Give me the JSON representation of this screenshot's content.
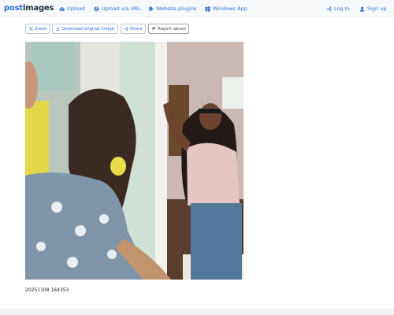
{
  "brand": {
    "part1": "post",
    "part2": "images"
  },
  "nav": {
    "upload": "Upload",
    "upload_url": "Upload via URL",
    "plugins": "Website plugins",
    "windows": "Windows App",
    "login": "Log In",
    "signup": "Sign up"
  },
  "toolbar": {
    "zoom": "Zoom",
    "download": "Download original image",
    "share": "Share",
    "report": "Report abuse"
  },
  "image": {
    "caption": "20251108 164353"
  },
  "colors": {
    "accent": "#2e6fd8",
    "navbar_bg": "#f8f9fa"
  },
  "icons": [
    "cloud-upload-icon",
    "globe-icon",
    "puzzle-icon",
    "windows-icon",
    "login-icon",
    "user-icon",
    "search-icon",
    "download-icon",
    "share-icon",
    "flag-icon"
  ]
}
